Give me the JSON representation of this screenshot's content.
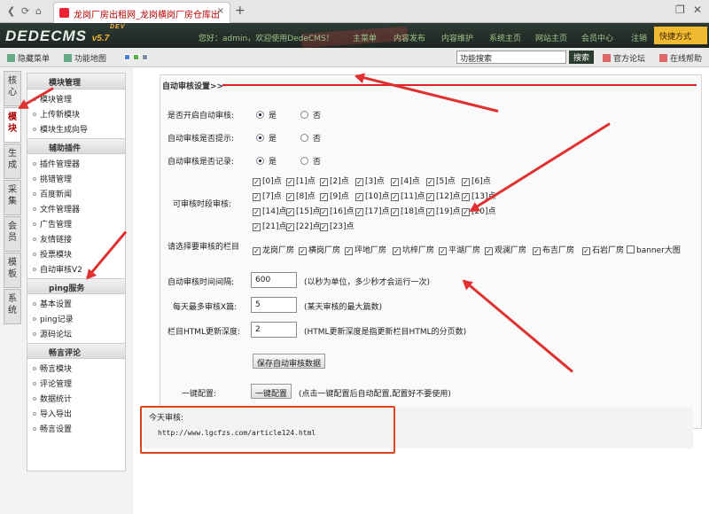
{
  "browser": {
    "tab_title": "龙岗厂房出租网_龙岗横岗厂房仓库出",
    "close_glyph": "×",
    "new_tab_glyph": "+"
  },
  "header": {
    "logo": "DEDECMS",
    "logo_version": "v5.7",
    "logo_badge": "DEV",
    "welcome": "您好：admin，欢迎使用DedeCMS！",
    "nav": [
      "主菜单",
      "内容发布",
      "内容维护",
      "系统主页",
      "网站主页",
      "会员中心",
      "注销"
    ],
    "quick": "快捷方式"
  },
  "toolbar": {
    "hide_menu": "隐藏菜单",
    "function_map": "功能地图",
    "search_value": "功能搜索",
    "search_button": "搜索",
    "forum": "官方论坛",
    "help": "在线帮助"
  },
  "sidebar": {
    "vtabs": [
      "核心",
      "模块",
      "生成",
      "采集",
      "会员",
      "模板",
      "系统"
    ],
    "sections": [
      {
        "title": "模块管理",
        "items": [
          "模块管理",
          "上传新模块",
          "模块生成向导"
        ]
      },
      {
        "title": "辅助插件",
        "items": [
          "插件管理器",
          "挑错管理",
          "百度新闻",
          "文件管理器",
          "广告管理",
          "友情链接",
          "投票模块",
          "自动审核V2"
        ]
      },
      {
        "title": "ping服务",
        "items": [
          "基本设置",
          "ping记录",
          "源码论坛"
        ]
      },
      {
        "title": "畅言评论",
        "items": [
          "畅言模块",
          "评论管理",
          "数据统计",
          "导入导出",
          "畅言设置"
        ]
      }
    ]
  },
  "panel": {
    "title": "自动审核设置>>",
    "yes": "是",
    "no": "否",
    "radios": [
      {
        "label": "是否开启自动审核:",
        "selected": "是"
      },
      {
        "label": "自动审核是否提示:",
        "selected": "是"
      },
      {
        "label": "自动审核是否记录:",
        "selected": "是"
      }
    ],
    "hours_label": "可审核时段审核:",
    "hours": [
      "[0]点",
      "[1]点",
      "[2]点",
      "[3]点",
      "[4]点",
      "[5]点",
      "[6]点",
      "[7]点",
      "[8]点",
      "[9]点",
      "[10]点",
      "[11]点",
      "[12]点",
      "[13]点",
      "[14]点",
      "[15]点",
      "[16]点",
      "[17]点",
      "[18]点",
      "[19]点",
      "[20]点",
      "[21]点",
      "[22]点",
      "[23]点"
    ],
    "category_label": "请选择要审核的栏目",
    "categories": [
      "龙岗厂房",
      "横岗厂房",
      "坪地厂房",
      "坑梓厂房",
      "平湖厂房",
      "观澜厂房",
      "布吉厂房",
      "石岩厂房",
      "banner大图"
    ],
    "categories_checked": [
      true,
      true,
      true,
      true,
      true,
      true,
      true,
      true,
      false
    ],
    "interval_label": "自动审核时间间隔:",
    "interval_value": "600",
    "interval_hint": "(以秒为单位，多少秒才会运行一次)",
    "max_label": "每天最多审核X篇:",
    "max_value": "5",
    "max_hint": "(某天审核的最大篇数)",
    "depth_label": "栏目HTML更新深度:",
    "depth_value": "2",
    "depth_hint": "(HTML更新深度是指更新栏目HTML的分页数)",
    "save_button": "保存自动审核数据",
    "oneclick_label": "一键配置:",
    "oneclick_button": "一键配置",
    "oneclick_hint": "(点击一键配置后自动配置,配置好不要使用)",
    "today_label": "今天审核:",
    "today_url": "http://www.lgcfzs.com/article124.html"
  },
  "colors": {
    "accent": "#efb931",
    "header": "#263029",
    "annotation_red": "#e03030"
  }
}
